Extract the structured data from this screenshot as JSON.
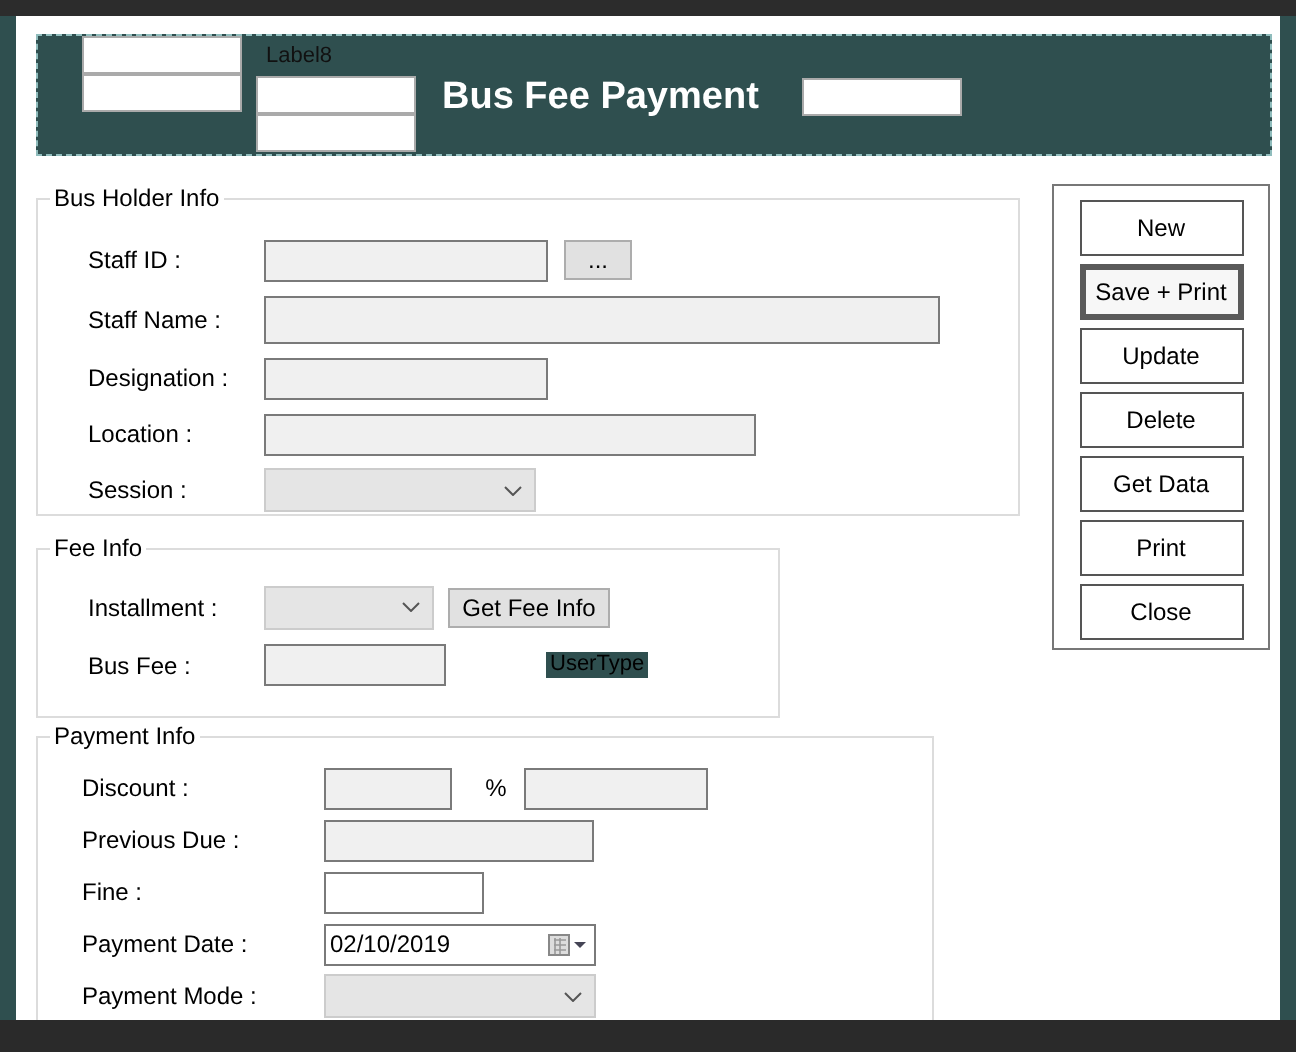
{
  "header": {
    "title": "Bus Fee Payment",
    "label": "Label8"
  },
  "groups": [
    {
      "title": "Bus Holder Info",
      "rows": [
        {
          "label": "Staff ID :",
          "controls": [
            {
              "kind": "text",
              "disabled": true
            },
            {
              "kind": "button",
              "text": "..."
            }
          ]
        },
        {
          "label": "Staff Name :",
          "controls": [
            {
              "kind": "text",
              "disabled": true
            }
          ]
        },
        {
          "label": "Designation :",
          "controls": [
            {
              "kind": "text",
              "disabled": true
            }
          ]
        },
        {
          "label": "Location :",
          "controls": [
            {
              "kind": "text",
              "disabled": true
            }
          ]
        },
        {
          "label": "Session :",
          "controls": [
            {
              "kind": "combo",
              "disabled": true
            }
          ]
        }
      ]
    },
    {
      "title": "Fee Info",
      "rows": [
        {
          "label": "Installment :",
          "controls": [
            {
              "kind": "combo",
              "disabled": true
            },
            {
              "kind": "button",
              "text": "Get Fee Info"
            }
          ]
        },
        {
          "label": "Bus Fee :",
          "controls": [
            {
              "kind": "text",
              "disabled": true
            },
            {
              "kind": "tag",
              "text": "UserType"
            }
          ]
        }
      ]
    },
    {
      "title": "Payment Info",
      "rows": [
        {
          "label": "Discount :",
          "controls": [
            {
              "kind": "text",
              "disabled": true
            },
            {
              "kind": "unit",
              "text": "%"
            },
            {
              "kind": "text",
              "disabled": true
            }
          ]
        },
        {
          "label": "Previous Due :",
          "controls": [
            {
              "kind": "text",
              "disabled": true
            }
          ]
        },
        {
          "label": "Fine :",
          "controls": [
            {
              "kind": "text",
              "disabled": false
            }
          ]
        },
        {
          "label": "Payment Date :",
          "controls": [
            {
              "kind": "date",
              "value": "02/10/2019"
            }
          ]
        },
        {
          "label": "Payment Mode :",
          "controls": [
            {
              "kind": "combo",
              "disabled": true
            }
          ]
        }
      ]
    }
  ],
  "buttons": [
    {
      "label": "New",
      "focused": false
    },
    {
      "label": "Save + Print",
      "focused": true
    },
    {
      "label": "Update",
      "focused": false
    },
    {
      "label": "Delete",
      "focused": false
    },
    {
      "label": "Get Data",
      "focused": false
    },
    {
      "label": "Print",
      "focused": false
    },
    {
      "label": "Close",
      "focused": false
    }
  ]
}
